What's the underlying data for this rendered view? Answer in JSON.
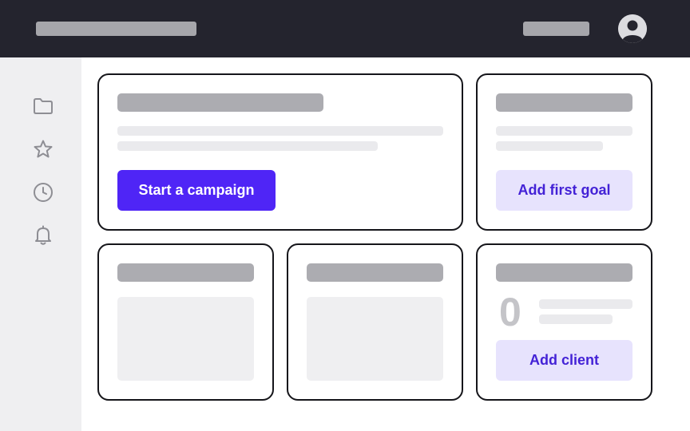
{
  "header": {
    "avatar_icon": "user-avatar-icon",
    "colors": {
      "background": "#24242e",
      "placeholder": "#a6a6ab"
    }
  },
  "sidebar": {
    "items": [
      {
        "icon": "folder-icon"
      },
      {
        "icon": "star-icon"
      },
      {
        "icon": "clock-icon"
      },
      {
        "icon": "bell-icon"
      }
    ]
  },
  "cards": {
    "campaign": {
      "button_label": "Start a campaign"
    },
    "goal": {
      "button_label": "Add first goal"
    },
    "clients": {
      "count": "0",
      "button_label": "Add client"
    }
  },
  "colors": {
    "accent": "#4f25f6",
    "accent_soft": "#e7e3fd",
    "accent_text": "#4322d6",
    "card_border": "#15151a"
  }
}
